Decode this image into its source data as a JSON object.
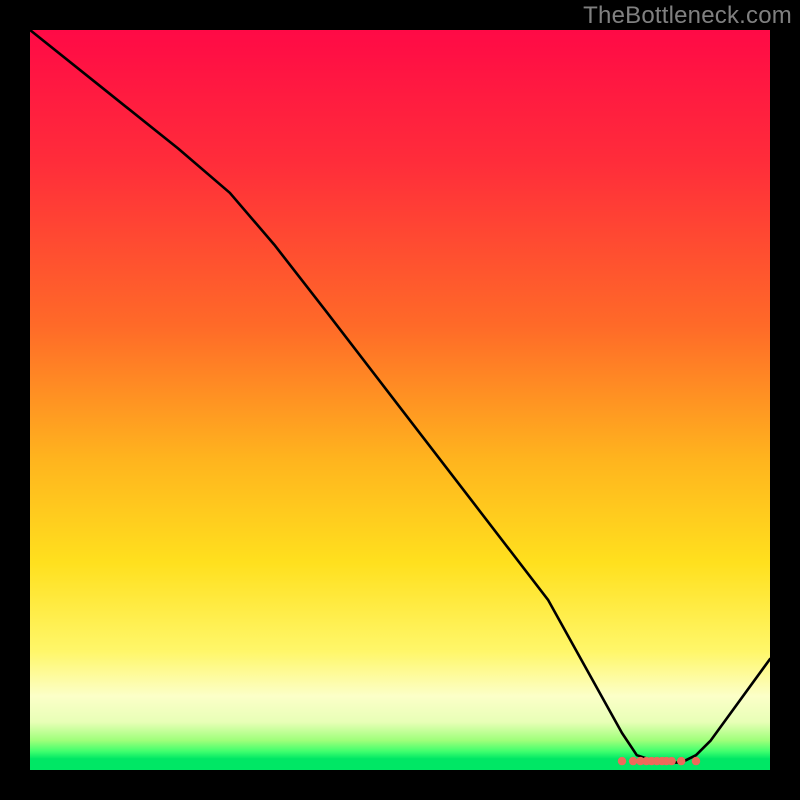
{
  "watermark": "TheBottleneck.com",
  "chart_data": {
    "type": "line",
    "title": "",
    "xlabel": "",
    "ylabel": "",
    "xlim": [
      0,
      100
    ],
    "ylim": [
      0,
      100
    ],
    "grid": false,
    "legend": false,
    "notes": "Background is a vertical gradient from red (top, high bottleneck) through orange/yellow to a thin green band at the very bottom (low/no bottleneck). The black line traces bottleneck percentage vs. an x parameter, dropping from ~100 at x=0 to ~0 in the x≈80–90 range, then rising again toward x=100. A short row of red dots marks the optimal (minimum-bottleneck) region near the bottom at x≈80–90.",
    "series": [
      {
        "name": "bottleneck-line",
        "color": "#000000",
        "x": [
          0,
          10,
          20,
          27,
          33,
          40,
          50,
          60,
          70,
          80,
          82,
          85,
          88,
          90,
          92,
          100
        ],
        "y": [
          100,
          92,
          84,
          78,
          71,
          62,
          49,
          36,
          23,
          5,
          2,
          1,
          1,
          2,
          4,
          15
        ]
      }
    ],
    "markers": {
      "name": "optimal-region-dots",
      "color": "#ef6a5a",
      "y": 1.2,
      "x": [
        80,
        81.5,
        82.5,
        83.3,
        84,
        84.7,
        85.4,
        86,
        86.7,
        88,
        90
      ]
    }
  }
}
